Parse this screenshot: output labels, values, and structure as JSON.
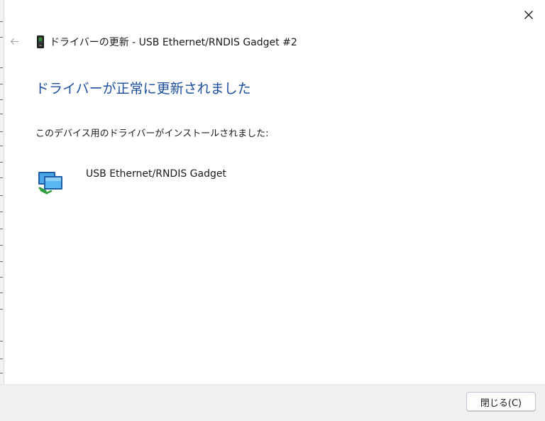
{
  "window": {
    "close_icon": "close-icon",
    "back_icon": "back-arrow-icon"
  },
  "header": {
    "icon": "usb-device-icon",
    "title": "ドライバーの更新 - USB Ethernet/RNDIS Gadget #2"
  },
  "main": {
    "heading": "ドライバーが正常に更新されました",
    "subtext": "このデバイス用のドライバーがインストールされました:",
    "device_icon": "network-adapter-icon",
    "device_name": "USB Ethernet/RNDIS Gadget"
  },
  "footer": {
    "close_button_label": "閉じる(C)"
  },
  "colors": {
    "heading": "#1d4e9d",
    "footer_bg": "#f0f0f0",
    "button_border": "#bcc6d4"
  }
}
